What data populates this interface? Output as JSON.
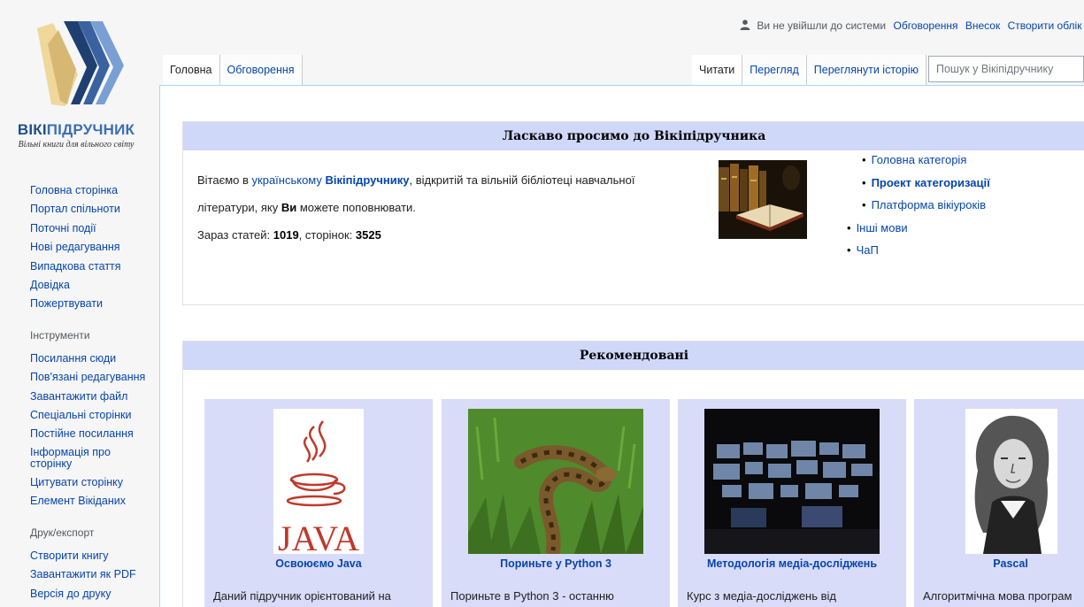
{
  "logo": {
    "title_a": "ВІКІ",
    "title_b": "ПІДРУЧНИК",
    "subtitle": "Вільні книги для вільного світу"
  },
  "personal": {
    "anon": "Ви не увійшли до системи",
    "talk": "Обговорення",
    "contrib": "Внесок",
    "create": "Створити облік"
  },
  "tabs": {
    "main": "Головна",
    "discussion": "Обговорення",
    "read": "Читати",
    "view": "Перегляд",
    "history": "Переглянути історію"
  },
  "search": {
    "placeholder": "Пошук у Вікіпідручнику"
  },
  "sidebar": {
    "nav": [
      "Головна сторінка",
      "Портал спільноти",
      "Поточні події",
      "Нові редагування",
      "Випадкова стаття",
      "Довідка",
      "Пожертвувати"
    ],
    "tools_heading": "Інструменти",
    "tools": [
      "Посилання сюди",
      "Пов'язані редагування",
      "Завантажити файл",
      "Спеціальні сторінки",
      "Постійне посилання",
      "Інформація про сторінку",
      "Цитувати сторінку",
      "Елемент Вікіданих"
    ],
    "print_heading": "Друк/експорт",
    "print": [
      "Створити книгу",
      "Завантажити як PDF",
      "Версія до друку"
    ]
  },
  "welcome": {
    "heading": "Ласкаво просимо до Вікіпідручника",
    "greeting_a": "Вітаємо в ",
    "greeting_link": "українському",
    "greeting_space": " ",
    "greeting_bold": "Вікіпідручнику",
    "greeting_b": ", відкритій та вільній бібліотеці навчальної",
    "line2_a": "літератури, яку ",
    "line2_bold": "Ви",
    "line2_b": " можете поповнювати.",
    "stats_a": "Зараз статей: ",
    "stats_articles": "1019",
    "stats_b": ", сторінок: ",
    "stats_pages": "3525",
    "links": [
      "Головна категорія",
      "Проект категоризації",
      "Платформа вікіуроків",
      "Інші мови",
      "ЧаП"
    ]
  },
  "recommended": {
    "heading": "Рекомендовані",
    "cards": [
      {
        "title": "Освоюємо Java",
        "desc": "Даний підручник орієнтований на"
      },
      {
        "title": "Пориньте у Python 3",
        "desc": "Пориньте в Python 3 - останню"
      },
      {
        "title": "Методологія медіа-досліджень",
        "desc": "Курс з медіа-досліджень від"
      },
      {
        "title": "Pascal",
        "desc": "Алгоритмічна мова програм"
      }
    ]
  },
  "colors": {
    "link": "#0645ad",
    "box_header": "#cfd8f9",
    "card_bg": "#d9dcf9",
    "sidebar_bg": "#f6f6f6"
  }
}
